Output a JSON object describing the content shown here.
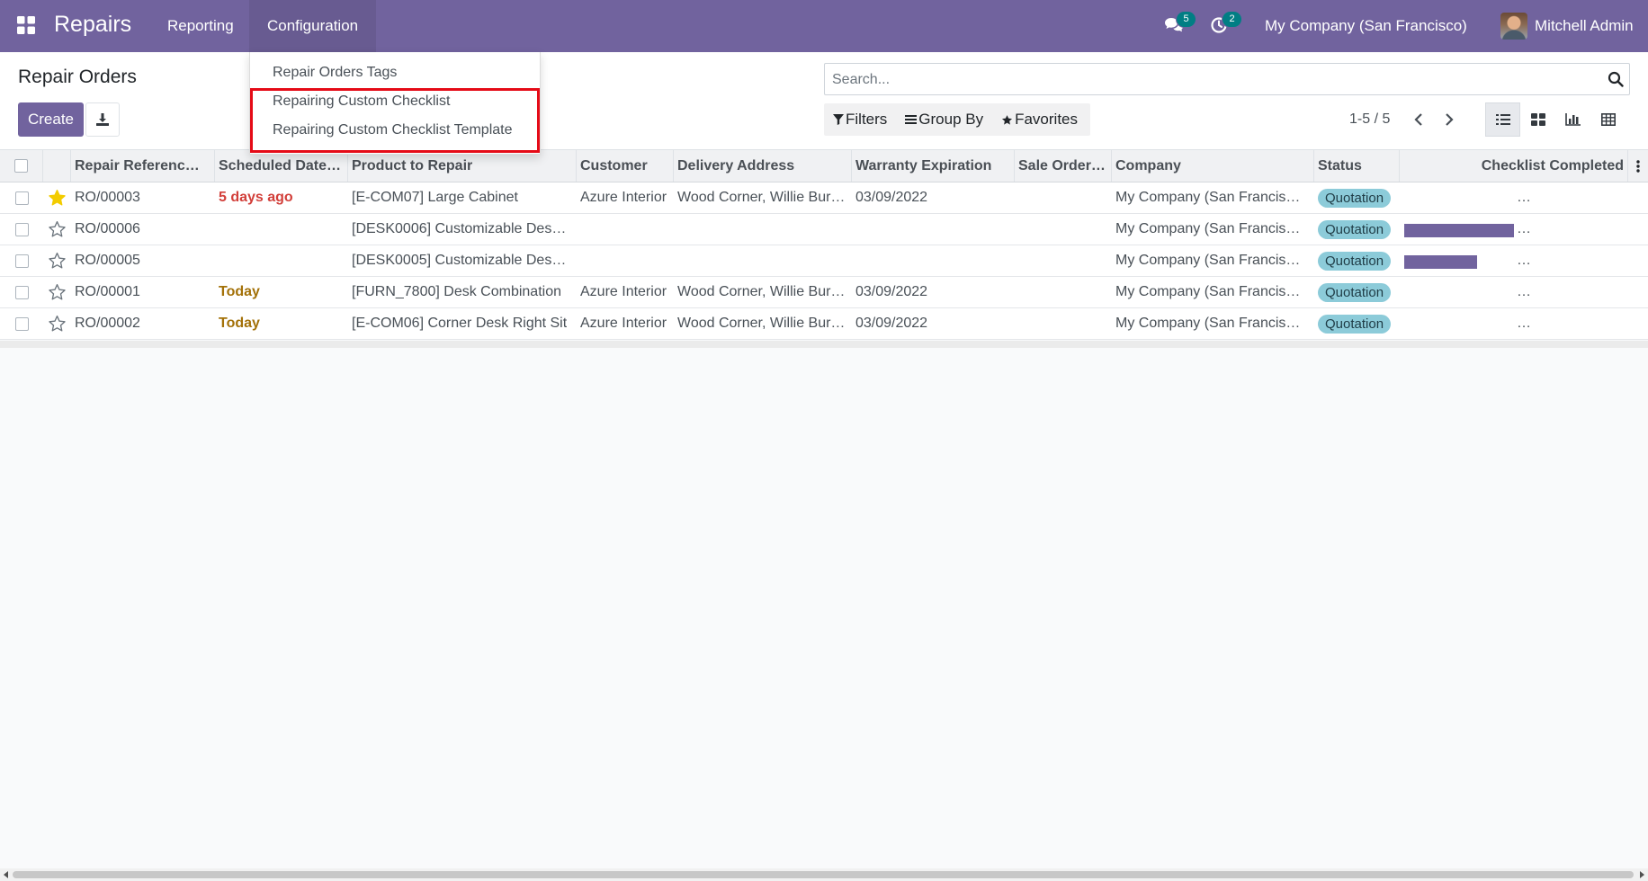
{
  "navbar": {
    "brand": "Repairs",
    "menu": [
      {
        "label": "Reporting"
      },
      {
        "label": "Configuration"
      }
    ],
    "messages_badge": "5",
    "activities_badge": "2",
    "company": "My Company (San Francisco)",
    "user": "Mitchell Admin"
  },
  "config_menu": {
    "items": [
      {
        "label": "Repair Orders Tags"
      },
      {
        "label": "Repairing Custom Checklist"
      },
      {
        "label": "Repairing Custom Checklist Template"
      }
    ]
  },
  "control": {
    "title": "Repair Orders",
    "create_label": "Create",
    "search_placeholder": "Search...",
    "filters_label": "Filters",
    "groupby_label": "Group By",
    "favorites_label": "Favorites",
    "pager": "1-5 / 5"
  },
  "table": {
    "columns": [
      "Repair Referenc…",
      "Scheduled Date…",
      "Product to Repair",
      "Customer",
      "Delivery Address",
      "Warranty Expiration",
      "Sale Order…",
      "Company",
      "Status",
      "Checklist Completed"
    ],
    "rows": [
      {
        "ref": "RO/00003",
        "starred": true,
        "date": "5 days ago",
        "date_state": "late",
        "product": "[E-COM07] Large Cabinet",
        "customer": "Azure Interior",
        "address": "Wood Corner, Willie Bur…",
        "warranty": "03/09/2022",
        "sale_order": "",
        "company": "My Company (San Francis…",
        "status": "Quotation",
        "checklist_progress": 0,
        "ellipsis": "…"
      },
      {
        "ref": "RO/00006",
        "starred": false,
        "date": "",
        "date_state": "",
        "product": "[DESK0006] Customizable Des…",
        "customer": "",
        "address": "",
        "warranty": "",
        "sale_order": "",
        "company": "My Company (San Francis…",
        "status": "Quotation",
        "checklist_progress": 100,
        "ellipsis": "…"
      },
      {
        "ref": "RO/00005",
        "starred": false,
        "date": "",
        "date_state": "",
        "product": "[DESK0005] Customizable Des…",
        "customer": "",
        "address": "",
        "warranty": "",
        "sale_order": "",
        "company": "My Company (San Francis…",
        "status": "Quotation",
        "checklist_progress": 66,
        "ellipsis": "…"
      },
      {
        "ref": "RO/00001",
        "starred": false,
        "date": "Today",
        "date_state": "today",
        "product": "[FURN_7800] Desk Combination",
        "customer": "Azure Interior",
        "address": "Wood Corner, Willie Bur…",
        "warranty": "03/09/2022",
        "sale_order": "",
        "company": "My Company (San Francis…",
        "status": "Quotation",
        "checklist_progress": 0,
        "ellipsis": "…"
      },
      {
        "ref": "RO/00002",
        "starred": false,
        "date": "Today",
        "date_state": "today",
        "product": "[E-COM06] Corner Desk Right Sit",
        "customer": "Azure Interior",
        "address": "Wood Corner, Willie Bur…",
        "warranty": "03/09/2022",
        "sale_order": "",
        "company": "My Company (San Francis…",
        "status": "Quotation",
        "checklist_progress": 0,
        "ellipsis": "…"
      }
    ]
  },
  "colors": {
    "brand": "#71639e",
    "badge": "#017e84",
    "late": "#d23f3a",
    "today": "#a37108",
    "status_pill": "#8ccbd9",
    "highlight": "#e50b17",
    "star_active": "#f3cc00"
  }
}
